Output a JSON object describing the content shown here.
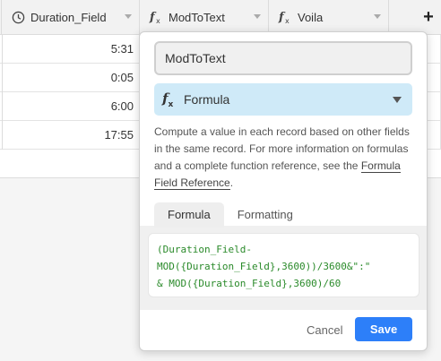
{
  "grid": {
    "columns": [
      {
        "name": "Duration_Field",
        "icon": "clock-icon"
      },
      {
        "name": "ModToText",
        "icon": "formula-icon"
      },
      {
        "name": "Voila",
        "icon": "formula-icon"
      }
    ],
    "add_column_label": "+",
    "rows": [
      {
        "duration": "5:31"
      },
      {
        "duration": "0:05"
      },
      {
        "duration": "6:00"
      },
      {
        "duration": "17:55"
      }
    ]
  },
  "field_editor": {
    "field_name": "ModToText",
    "field_type": "Formula",
    "type_icon": "formula-icon",
    "description_text": "Compute a value in each record based on other fields in the same record. For more information on formulas and a complete function reference, see the ",
    "reference_link": "Formula Field Reference",
    "description_end": ".",
    "tabs": [
      {
        "label": "Formula",
        "active": true
      },
      {
        "label": "Formatting",
        "active": false
      }
    ],
    "formula": "(Duration_Field-\nMOD({Duration_Field},3600))/3600&\":\"\n& MOD({Duration_Field},3600)/60",
    "cancel_label": "Cancel",
    "save_label": "Save"
  },
  "colors": {
    "accent": "#2d7ff9",
    "type_select_bg": "#cfeaf8",
    "formula_text": "#2a8a2a"
  }
}
